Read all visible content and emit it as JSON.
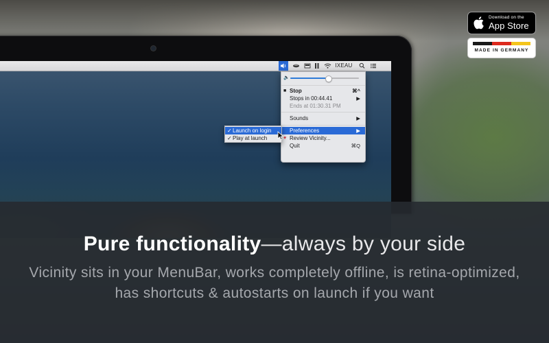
{
  "menubar": {
    "app_name": "IXEAU",
    "icons": [
      "speaker-icon",
      "volume-icon",
      "display-icon",
      "battery-icon",
      "wifi-icon",
      "search-icon",
      "list-icon"
    ]
  },
  "menu": {
    "volume_level": 0.55,
    "items": {
      "stop": {
        "label": "Stop",
        "shortcut": "⌘^"
      },
      "stops_in": {
        "label": "Stops in 00:44.41"
      },
      "ends_at": {
        "label": "Ends at 01:30.31 PM"
      },
      "sounds": {
        "label": "Sounds"
      },
      "preferences": {
        "label": "Preferences"
      },
      "review": {
        "label": "Review Vicinity..."
      },
      "quit": {
        "label": "Quit",
        "shortcut": "⌘Q"
      }
    }
  },
  "submenu": {
    "launch_on_login": {
      "label": "Launch on login",
      "checked": true
    },
    "play_at_launch": {
      "label": "Play at launch",
      "checked": true
    }
  },
  "badges": {
    "app_store_small": "Download on the",
    "app_store_big": "App Store",
    "germany": "MADE IN GERMANY",
    "flag_colors": [
      "#1a1a1a",
      "#dd2a1e",
      "#f4c51c"
    ]
  },
  "caption": {
    "headline_strong": "Pure functionality",
    "headline_rest": "—always by your side",
    "subtitle": "Vicinity sits in your MenuBar, works completely offline, is retina-optimized, has shortcuts & autostarts on launch if you want"
  },
  "colors": {
    "accent": "#2a6ad6"
  }
}
